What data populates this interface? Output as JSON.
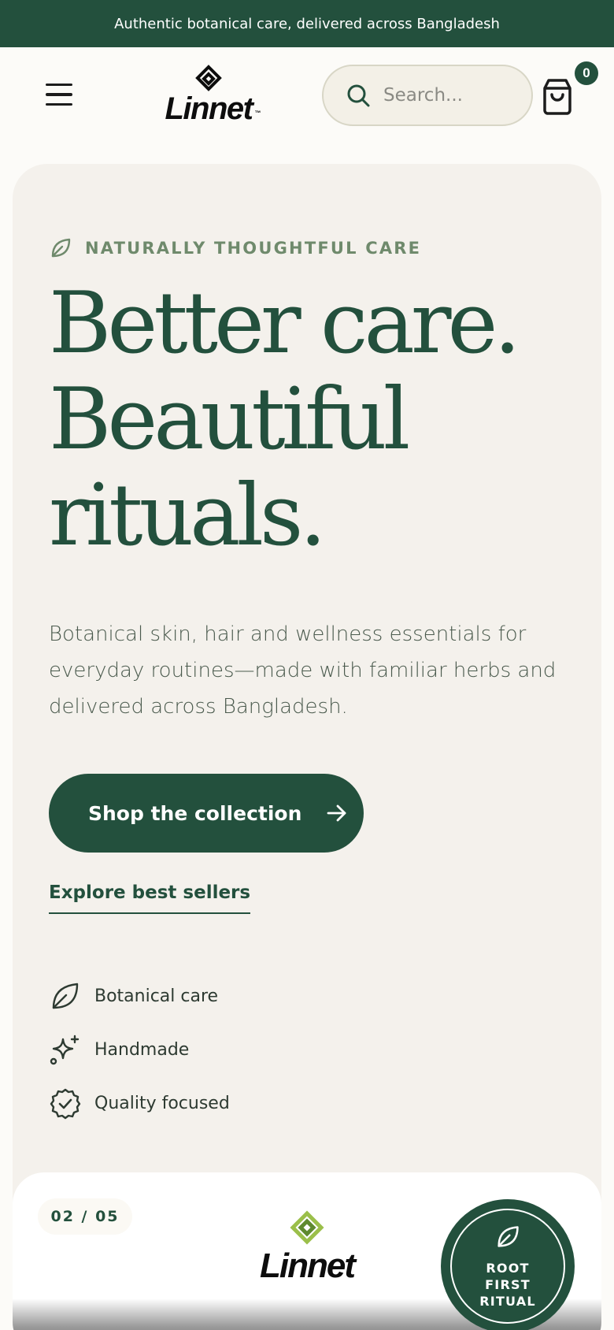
{
  "announcement": "Authentic botanical care, delivered across Bangladesh",
  "header": {
    "logo_text": "Linnet",
    "logo_tm": "™",
    "search_placeholder": "Search...",
    "cart_count": "0"
  },
  "hero": {
    "eyebrow": "NATURALLY THOUGHTFUL CARE",
    "headline": [
      "Better care.",
      "Beautiful",
      "rituals."
    ],
    "description": "Botanical skin, hair and wellness essentials for everyday routines—made with familiar herbs and delivered across Bangladesh.",
    "cta_label": "Shop the collection",
    "secondary_link": "Explore best sellers",
    "features": [
      {
        "label": "Botanical care",
        "icon": "leaf-icon"
      },
      {
        "label": "Handmade",
        "icon": "sparkles-icon"
      },
      {
        "label": "Quality focused",
        "icon": "badge-check-icon"
      }
    ]
  },
  "product_card": {
    "slide_counter": "02 / 05",
    "logo_text": "Linnet",
    "badge_text": "ROOT FIRST RITUAL"
  },
  "colors": {
    "brand_green": "#23503d",
    "hero_bg": "#f4f1ec",
    "page_bg": "#fcfbf8",
    "eyebrow": "#6f8a6c"
  }
}
